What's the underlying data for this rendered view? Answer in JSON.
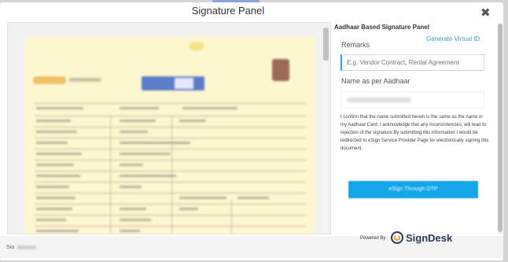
{
  "modal": {
    "title": "Signature Panel",
    "close_label": "✖"
  },
  "panel": {
    "title": "Aadhaar Based Signature Panel",
    "generate_link": "Generate Virtual ID",
    "remarks_label": "Remarks",
    "remarks_placeholder": "E.g. Vendor Contract, Rental Agreement",
    "name_label": "Name as per Aadhaar",
    "consent_text": "I confirm that the name submitted herein is the same as the name in my Aadhaar Card. I acknowledge that any inconsistencies, will lead to rejection of the signature.By submitting this information I would be redirected to eSign Service Provider Page for electronically signing this document.",
    "esign_button": "eSign Through OTP",
    "powered_by": "Powered By",
    "brand": "SignDesk"
  },
  "footer": {
    "label": "Sia"
  },
  "colors": {
    "accent": "#15a6ea",
    "link": "#4a9bbd",
    "brand_dark": "#2a3b55",
    "brand_orange": "#f19b3a",
    "document_bg": "#fdf7cf"
  }
}
